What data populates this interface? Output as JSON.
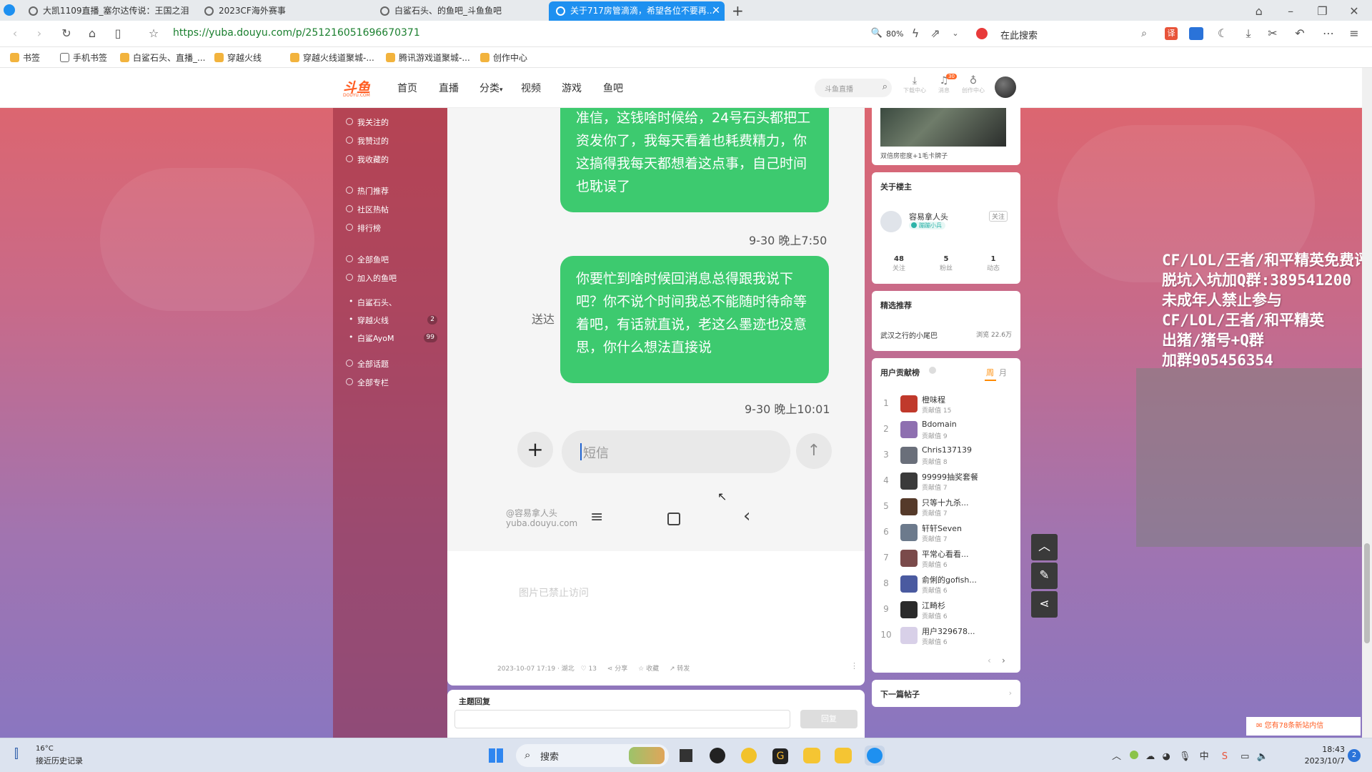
{
  "browser": {
    "tabs": [
      {
        "title": "大凯1109直播_塞尔达传说：王国之泪"
      },
      {
        "title": "2023CF海外赛事"
      },
      {
        "title": "白鲨石头、的鱼吧_斗鱼鱼吧"
      },
      {
        "title": "关于717房管滴滴，希望各位不要再..."
      }
    ],
    "url": "https://yuba.douyu.com/p/251216051696670371",
    "zoom": "80%",
    "search_label": "在此搜索",
    "bookmarks": [
      {
        "label": "书签"
      },
      {
        "label": "手机书签"
      },
      {
        "label": "白鲨石头、直播_..."
      },
      {
        "label": "穿越火线"
      },
      {
        "label": "穿越火线道聚城-..."
      },
      {
        "label": "腾讯游戏道聚城-..."
      },
      {
        "label": "创作中心"
      }
    ]
  },
  "site": {
    "logo_text": "斗鱼",
    "logo_sub": "DOUYU.COM",
    "nav": [
      "首页",
      "直播",
      "分类",
      "视频",
      "游戏",
      "鱼吧"
    ],
    "search_placeholder": "斗鱼直播",
    "header_icons": [
      {
        "icon": "download-icon",
        "label": "下载中心"
      },
      {
        "icon": "bell-icon",
        "label": "消息",
        "badge": "30"
      },
      {
        "icon": "bulb-icon",
        "label": "创作中心"
      }
    ]
  },
  "left_nav": {
    "group1": [
      "我关注的",
      "我赞过的",
      "我收藏的"
    ],
    "group2": [
      "热门推荐",
      "社区热帖",
      "排行榜"
    ],
    "group3": [
      "全部鱼吧",
      "加入的鱼吧"
    ],
    "joined": [
      {
        "label": "白鲨石头、",
        "badge": ""
      },
      {
        "label": "穿越火线",
        "badge": "2"
      },
      {
        "label": "白鲨AyoM",
        "badge": "99"
      }
    ],
    "group4": [
      "全部话题",
      "全部专栏"
    ]
  },
  "post": {
    "msg1": "准信，这钱啥时候给，24号石头都把工资发你了，我每天看着也耗费精力，你这搞得我每天都想着这点事，自己时间也耽误了",
    "time1": "9-30 晚上7:50",
    "sent_label": "送达",
    "msg2": "你要忙到啥时候回消息总得跟我说下吧？你不说个时间我总不能随时待命等着吧，有话就直说，老这么墨迹也没意思，你什么想法直接说",
    "time2": "9-30 晚上10:01",
    "input_placeholder": "短信",
    "watermark1": "@容易拿人头",
    "watermark2": "yuba.douyu.com",
    "blocked_text": "图片已禁止访问",
    "meta_date": "2023-10-07 17:19 · 湖北",
    "like_count": "13",
    "share_label": "分享",
    "fav_label": "收藏",
    "forward_label": "转发",
    "reply_title": "主题回复",
    "reply_button": "回复"
  },
  "sidebar": {
    "video_caption": "双倍房密度+1毛卡牌子",
    "author_title": "关于楼主",
    "author_name": "容易拿人头",
    "author_tag": "蹦蹦小兵",
    "follow_label": "关注",
    "stats": [
      {
        "value": "48",
        "label": "关注"
      },
      {
        "value": "5",
        "label": "粉丝"
      },
      {
        "value": "1",
        "label": "动态"
      }
    ],
    "featured_title": "精选推荐",
    "featured_item": "武汉之行的小尾巴",
    "featured_views": "浏览 22.6万",
    "ranking_title": "用户贡献榜",
    "tab_week": "周",
    "tab_month": "月",
    "ranking": [
      {
        "rank": "1",
        "name": "橙味程",
        "score": "贡献值 15"
      },
      {
        "rank": "2",
        "name": "Bdomain",
        "score": "贡献值 9"
      },
      {
        "rank": "3",
        "name": "Chris137139",
        "score": "贡献值 8"
      },
      {
        "rank": "4",
        "name": "99999抽奖套餐",
        "score": "贡献值 7"
      },
      {
        "rank": "5",
        "name": "只等十九杀...",
        "score": "贡献值 7"
      },
      {
        "rank": "6",
        "name": "轩轩Seven",
        "score": "贡献值 7"
      },
      {
        "rank": "7",
        "name": "平常心看看...",
        "score": "贡献值 6"
      },
      {
        "rank": "8",
        "name": "俞俐的gofish...",
        "score": "贡献值 6"
      },
      {
        "rank": "9",
        "name": "江畸杉",
        "score": "贡献值 6"
      },
      {
        "rank": "10",
        "name": "用户329678...",
        "score": "贡献值 6"
      }
    ],
    "next_post": "下一篇帖子"
  },
  "overlay": {
    "lines": [
      "CF/LOL/王者/和平精英免费评估",
      "脱坑入坑加Q群:389541200",
      "未成年人禁止参与",
      "CF/LOL/王者/和平精英",
      "出猪/猪号+Q群",
      "加群905456354"
    ]
  },
  "notice": "您有78条新站内信",
  "taskbar": {
    "weather_temp": "16°C",
    "weather_desc": "接近历史记录",
    "search_label": "搜索",
    "time": "18:43",
    "date": "2023/10/7",
    "notif_count": "2"
  },
  "colors": {
    "tab_active": "#1e90f0",
    "bubble": "#3dca6f",
    "brand": "#ff5d23"
  }
}
